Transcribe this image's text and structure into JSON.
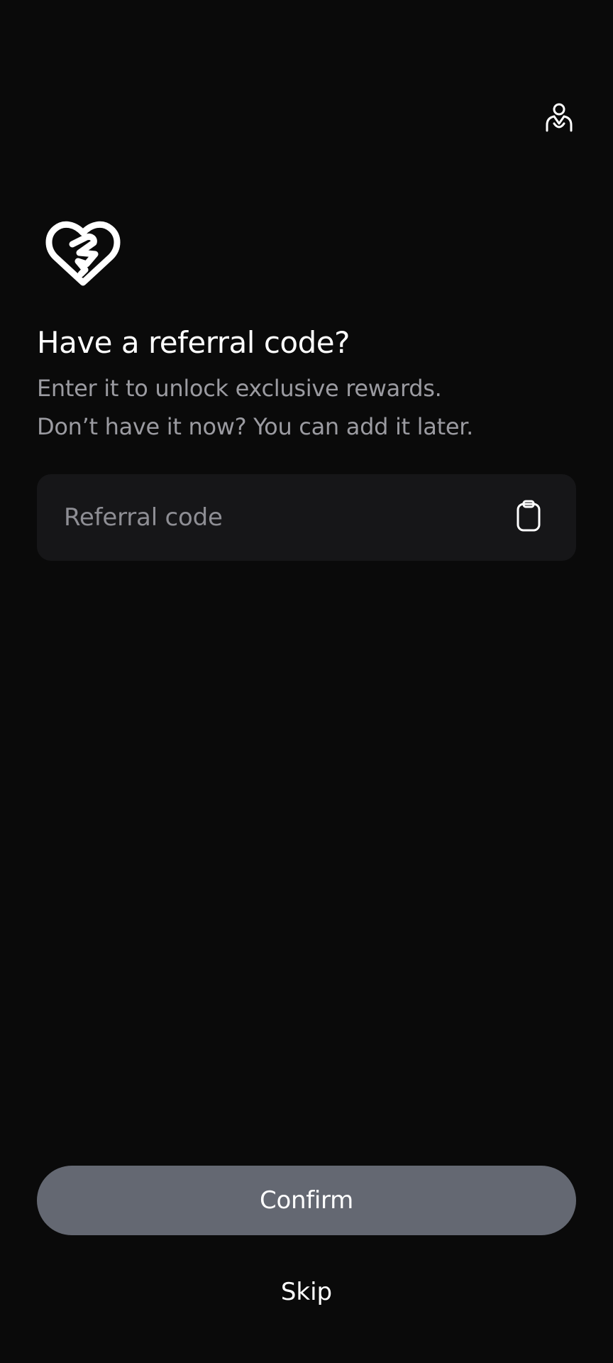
{
  "header": {
    "support_icon": "support-agent-icon"
  },
  "hero": {
    "icon": "heart-handshake-icon",
    "title": "Have a referral code?",
    "subtitle_line1": "Enter it to unlock exclusive rewards.",
    "subtitle_line2": "Don’t have it now? You can add it later."
  },
  "referral_field": {
    "value": "",
    "placeholder": "Referral code",
    "paste_icon": "clipboard-icon"
  },
  "actions": {
    "confirm_label": "Confirm",
    "skip_label": "Skip"
  },
  "colors": {
    "background": "#0a0a0a",
    "field_background": "#161618",
    "subtitle_text": "#9b9ba1",
    "confirm_disabled": "#646872"
  }
}
